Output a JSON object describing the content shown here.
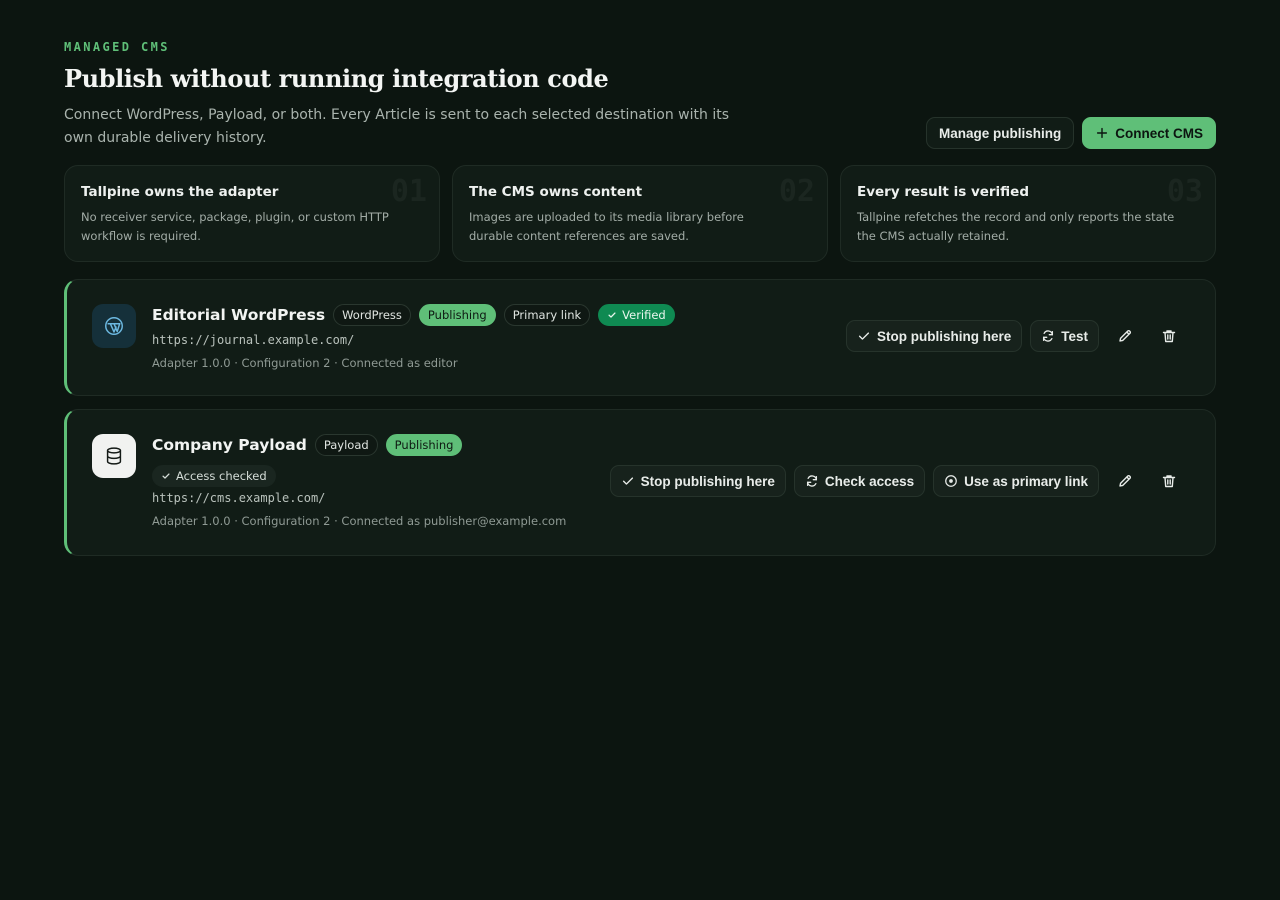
{
  "header": {
    "eyebrow": "MANAGED CMS",
    "title": "Publish without running integration code",
    "description": "Connect WordPress, Payload, or both. Every Article is sent to each selected destination with its own durable delivery history.",
    "manage_label": "Manage publishing",
    "connect_label": "Connect CMS"
  },
  "features": [
    {
      "num": "01",
      "title": "Tallpine owns the adapter",
      "text": "No receiver service, package, plugin, or custom HTTP workflow is required."
    },
    {
      "num": "02",
      "title": "The CMS owns content",
      "text": "Images are uploaded to its media library before durable content references are saved."
    },
    {
      "num": "03",
      "title": "Every result is verified",
      "text": "Tallpine refetches the record and only reports the state the CMS actually retained."
    }
  ],
  "connections": [
    {
      "name": "Editorial WordPress",
      "badges": {
        "type": "WordPress",
        "status": "Publishing",
        "link": "Primary link",
        "verified": "Verified"
      },
      "url": "https://journal.example.com/",
      "meta": "Adapter 1.0.0 · Configuration 2 · Connected as editor",
      "actions": {
        "stop": "Stop publishing here",
        "test": "Test"
      }
    },
    {
      "name": "Company Payload",
      "badges": {
        "type": "Payload",
        "status": "Publishing",
        "access": "Access checked"
      },
      "url": "https://cms.example.com/",
      "meta": "Adapter 1.0.0 · Configuration 2 · Connected as publisher@example.com",
      "actions": {
        "stop": "Stop publishing here",
        "check": "Check access",
        "primary": "Use as primary link"
      }
    }
  ],
  "colors": {
    "accent": "#5fbf78",
    "background": "#0c1510",
    "verified": "#0f8a52"
  }
}
